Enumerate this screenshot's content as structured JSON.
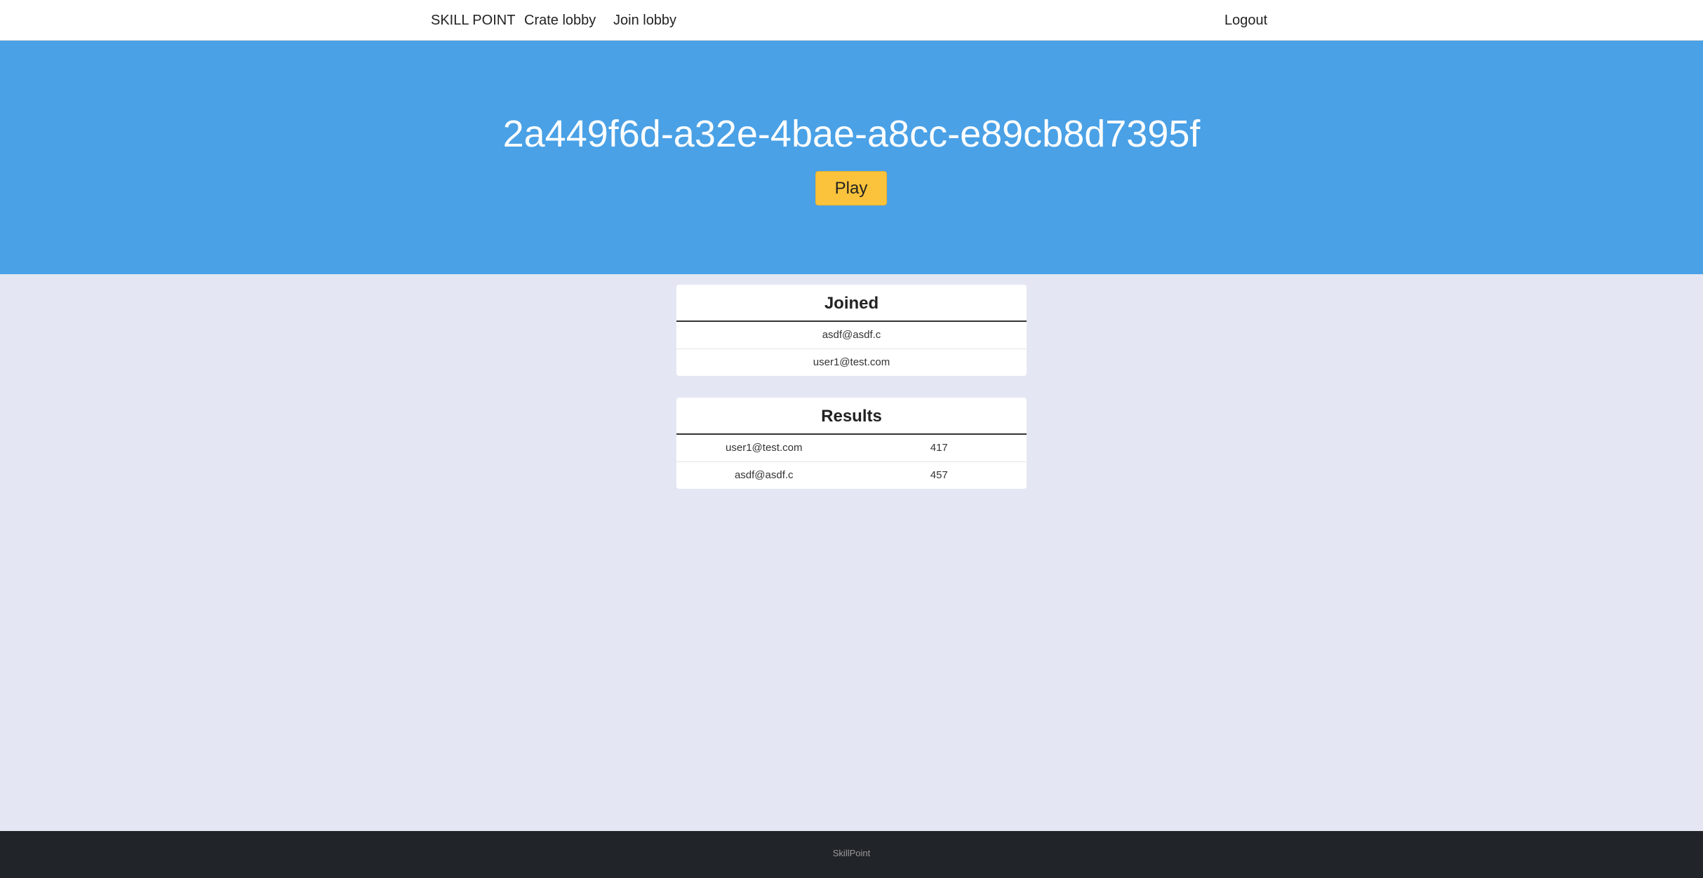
{
  "nav": {
    "brand": "SKILL POINT",
    "create_lobby": "Crate lobby",
    "join_lobby": "Join lobby",
    "logout": "Logout"
  },
  "hero": {
    "lobby_id": "2a449f6d-a32e-4bae-a8cc-e89cb8d7395f",
    "play_label": "Play",
    "background_color": "#4aa1e6",
    "button_color": "#fbc33b"
  },
  "joined": {
    "title": "Joined",
    "users": [
      "asdf@asdf.c",
      "user1@test.com"
    ]
  },
  "results": {
    "title": "Results",
    "rows": [
      {
        "user": "user1@test.com",
        "score": "417"
      },
      {
        "user": "asdf@asdf.c",
        "score": "457"
      }
    ]
  },
  "footer": {
    "text": "SkillPoint"
  }
}
